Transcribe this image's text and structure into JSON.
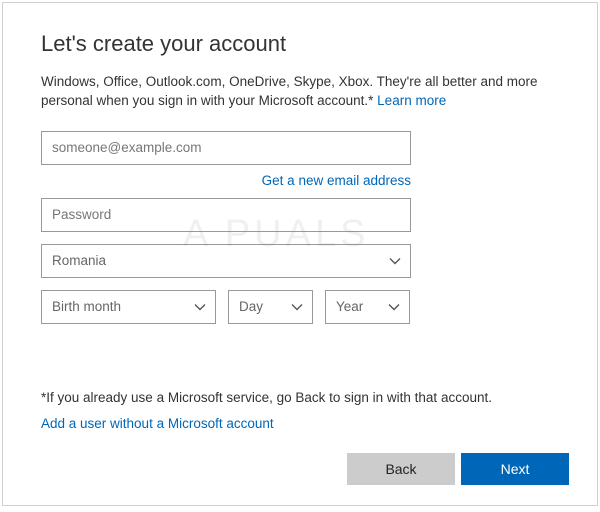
{
  "title": "Let's create your account",
  "intro_text": "Windows, Office, Outlook.com, OneDrive, Skype, Xbox. They're all better and more personal when you sign in with your Microsoft account.* ",
  "learn_more": "Learn more",
  "email_placeholder": "someone@example.com",
  "get_new_email": "Get a new email address",
  "password_placeholder": "Password",
  "country_value": "Romania",
  "birth_month": "Birth month",
  "birth_day": "Day",
  "birth_year": "Year",
  "footer_note": "*If you already use a Microsoft service, go Back to sign in with that account.",
  "add_user_link": "Add a user without a Microsoft account",
  "back_label": "Back",
  "next_label": "Next",
  "watermark": "A   PUALS"
}
